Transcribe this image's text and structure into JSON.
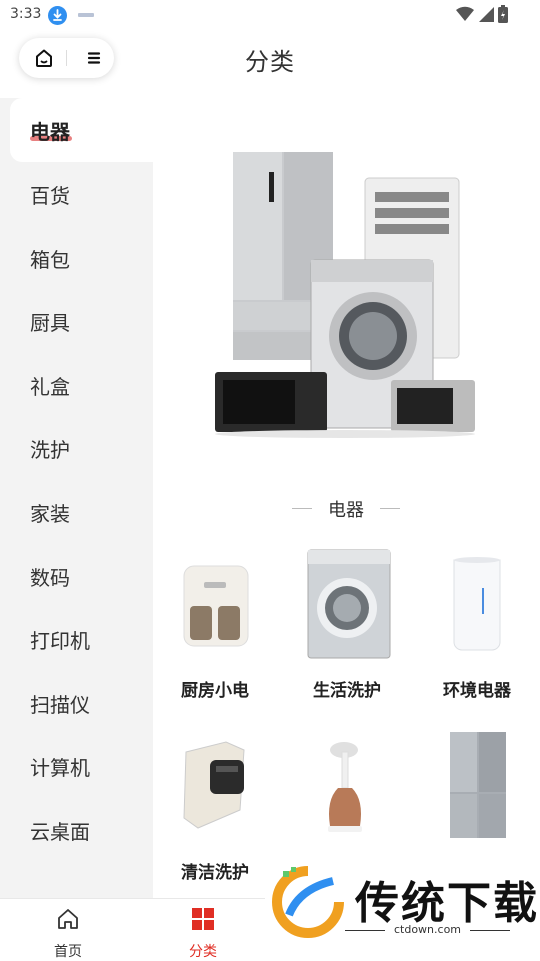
{
  "status_bar": {
    "time": "3:33"
  },
  "header": {
    "title": "分类"
  },
  "sidebar": {
    "items": [
      {
        "label": "电器",
        "active": true
      },
      {
        "label": "百货"
      },
      {
        "label": "箱包"
      },
      {
        "label": "厨具"
      },
      {
        "label": "礼盒"
      },
      {
        "label": "洗护"
      },
      {
        "label": "家装"
      },
      {
        "label": "数码"
      },
      {
        "label": "打印机"
      },
      {
        "label": "扫描仪"
      },
      {
        "label": "计算机"
      },
      {
        "label": "云桌面"
      }
    ]
  },
  "main": {
    "section_title": "电器",
    "categories": [
      {
        "label": "厨房小电",
        "icon": "air-fryer"
      },
      {
        "label": "生活洗护",
        "icon": "washing-machine"
      },
      {
        "label": "环境电器",
        "icon": "humidifier"
      },
      {
        "label": "清洁洗护",
        "icon": "mite-cleaner"
      },
      {
        "label": "",
        "icon": "garment-steamer"
      },
      {
        "label": "",
        "icon": "refrigerator"
      }
    ]
  },
  "tabbar": {
    "tabs": [
      {
        "label": "首页",
        "icon": "home-icon"
      },
      {
        "label": "分类",
        "icon": "category-icon",
        "active": true
      }
    ]
  },
  "watermark": {
    "brand": "传统下载",
    "url": "ctdown.com"
  },
  "colors": {
    "accent": "#e02e24",
    "sidebar_bg": "#f3f3f3",
    "download_badge": "#2f8ff0"
  }
}
